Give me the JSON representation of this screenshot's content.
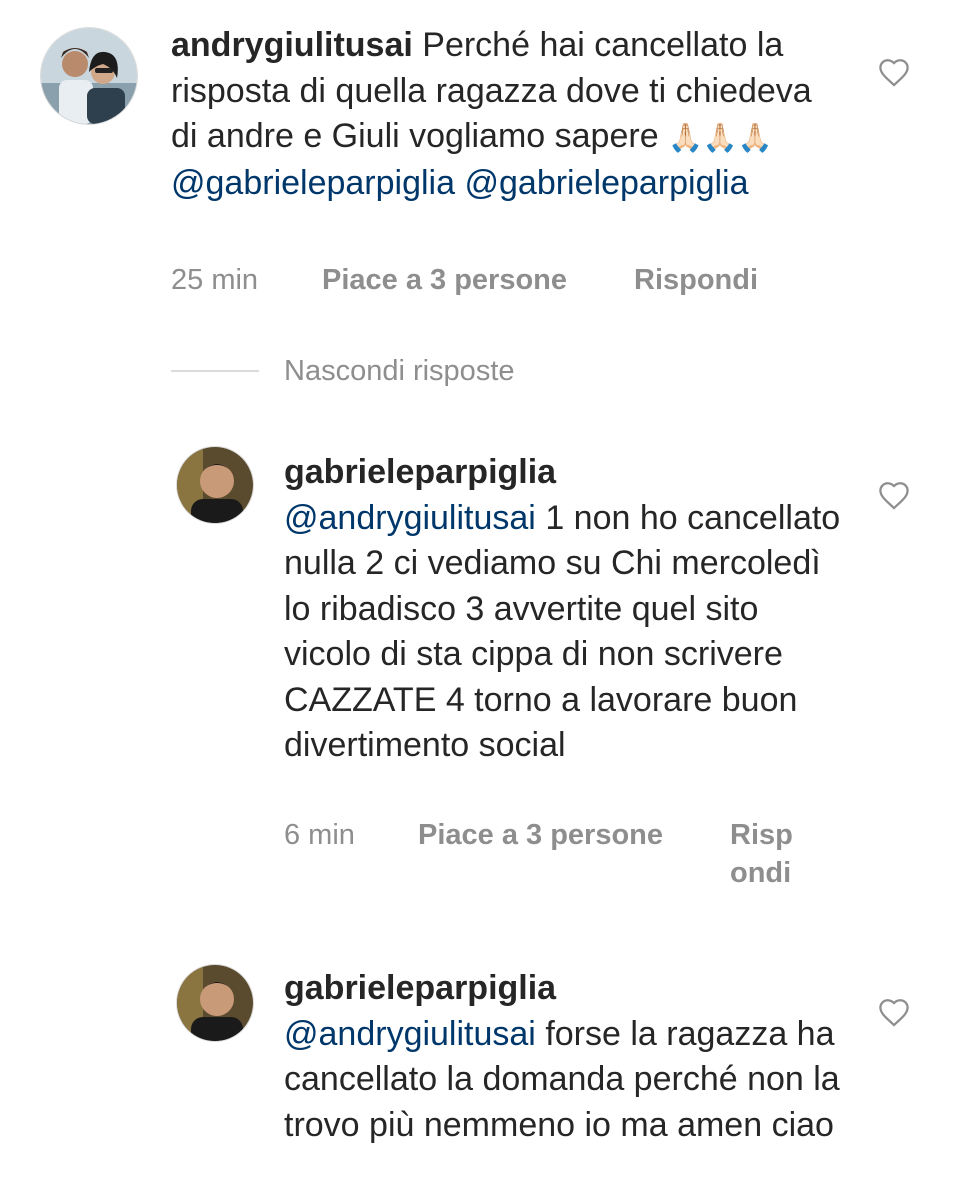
{
  "comments": [
    {
      "username": "andrygiulitusai",
      "text": " Perché hai cancellato la risposta di quella ragazza dove ti chiedeva di andre e Giuli vogliamo sapere ",
      "emoji": "🙏🏻🙏🏻🙏🏻",
      "mention_1": "@gabrieleparpiglia",
      "mention_2": "@gabrieleparpiglia",
      "time": "25 min",
      "likes": "Piace a 3 persone",
      "reply": "Rispondi"
    }
  ],
  "hide_replies": "Nascondi risposte",
  "replies": [
    {
      "username": "gabrieleparpiglia",
      "mention": "@andrygiulitusai",
      "text": " 1 non ho cancellato nulla 2 ci vediamo su Chi mercoledì lo ribadisco 3 avvertite quel sito vicolo di sta cippa di non scrivere CAZZATE 4 torno a lavorare buon divertimento social",
      "time": "6 min",
      "likes": "Piace a 3 persone",
      "reply_line1": "Risp",
      "reply_line2": "ondi"
    },
    {
      "username": "gabrieleparpiglia",
      "mention": "@andrygiulitusai",
      "text": " forse la ragazza ha cancellato la domanda perché non la trovo più nemmeno io ma amen ciao"
    }
  ],
  "colors": {
    "text": "#262626",
    "meta": "#8e8e8e",
    "mention": "#00376b",
    "divider": "#dbdbdb"
  },
  "icons": [
    "heart-outline-icon",
    "avatar-photo"
  ]
}
